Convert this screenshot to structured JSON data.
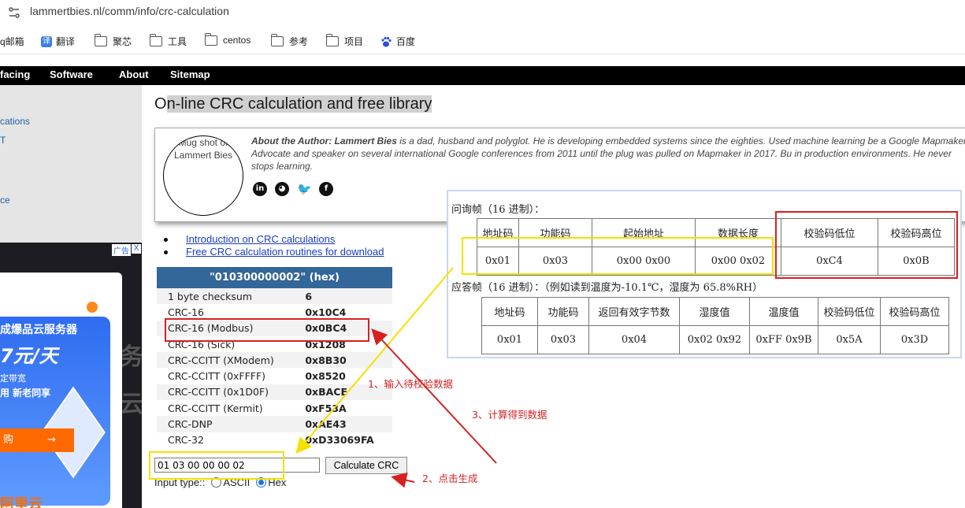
{
  "browser": {
    "url": "lammertbies.nl/comm/info/crc-calculation",
    "bookmarks": [
      {
        "label": "q邮箱",
        "icon": "none"
      },
      {
        "label": "翻译",
        "icon": "translate-icon"
      },
      {
        "label": "聚芯",
        "icon": "folder-icon"
      },
      {
        "label": "工具",
        "icon": "folder-icon"
      },
      {
        "label": "centos",
        "icon": "folder-icon"
      },
      {
        "label": "参考",
        "icon": "folder-icon"
      },
      {
        "label": "项目",
        "icon": "folder-icon"
      },
      {
        "label": "百度",
        "icon": "baidu-icon"
      }
    ]
  },
  "nav": {
    "items": [
      "facing",
      "Software",
      "About",
      "Sitemap"
    ]
  },
  "sidebar": {
    "links": [
      "cations",
      "T",
      "ce"
    ]
  },
  "ad": {
    "tag": "广告",
    "close": "X",
    "line1": "云",
    "line2": "成爆品云服务器",
    "line3": "7元/天",
    "line4": "定带宽",
    "line5": "用 新老同享",
    "buy": "购",
    "arrow": "→",
    "brand": "阿里云",
    "ghost1": "务",
    "ghost2": "云"
  },
  "page": {
    "title_first": "O",
    "title_rest": "n-line CRC calculation and free library",
    "author": {
      "mug_alt": "Mug shot of Lammert Bies",
      "label": "About the Author: Lammert Bies",
      "text": " is a dad, husband and polyglot. He is developing embedded systems since the eighties. Used machine learning be a Google Mapmaker Advocate and speaker on several international Google conferences from 2011 until the plug was pulled on Mapmaker in 2017. Bu in production environments. He never stops learning."
    },
    "links": [
      "Introduction on CRC calculations",
      "Free CRC calculation routines for download"
    ]
  },
  "crc": {
    "header": "\"010300000002\" (hex)",
    "rows": [
      {
        "name": "1 byte checksum",
        "value": "6"
      },
      {
        "name": "CRC-16",
        "value": "0x10C4"
      },
      {
        "name": "CRC-16 (Modbus)",
        "value": "0x0BC4"
      },
      {
        "name": "CRC-16 (Sick)",
        "value": "0x1208"
      },
      {
        "name": "CRC-CCITT (XModem)",
        "value": "0x8B30"
      },
      {
        "name": "CRC-CCITT (0xFFFF)",
        "value": "0x8520"
      },
      {
        "name": "CRC-CCITT (0x1D0F)",
        "value": "0xBACE"
      },
      {
        "name": "CRC-CCITT (Kermit)",
        "value": "0xF53A"
      },
      {
        "name": "CRC-DNP",
        "value": "0xAE43"
      },
      {
        "name": "CRC-32",
        "value": "0xD33069FA"
      }
    ],
    "input_value": "01 03 00 00 00 02",
    "button": "Calculate CRC",
    "input_type_label": "Input type::",
    "ascii": "ASCII",
    "hex": "Hex"
  },
  "overlay": {
    "query_title": "问询帧（16 进制）：",
    "query_headers": [
      "地址码",
      "功能码",
      "起始地址",
      "数据长度",
      "校验码低位",
      "校验码高位"
    ],
    "query_values": [
      "0x01",
      "0x03",
      "0x00  0x00",
      "0x00  0x02",
      "0xC4",
      "0x0B"
    ],
    "reply_title": "应答帧（16 进制）：（例如读到温度为-10.1℃，湿度为 65.8%RH）",
    "reply_headers": [
      "地址码",
      "功能码",
      "返回有效字节数",
      "湿度值",
      "温度值",
      "校验码低位",
      "校验码高位"
    ],
    "reply_values": [
      "0x01",
      "0x03",
      "0x04",
      "0x02 0x92",
      "0xFF 0x9B",
      "0x5A",
      "0x3D"
    ]
  },
  "annotations": {
    "step1": "1、输入待校验数据",
    "step2": "2、点击生成",
    "step3": "3、计算得到数据"
  },
  "colors": {
    "nav": "#000000",
    "table_header": "#336699",
    "annotation": "#d62020",
    "highlight": "#f5e000"
  }
}
